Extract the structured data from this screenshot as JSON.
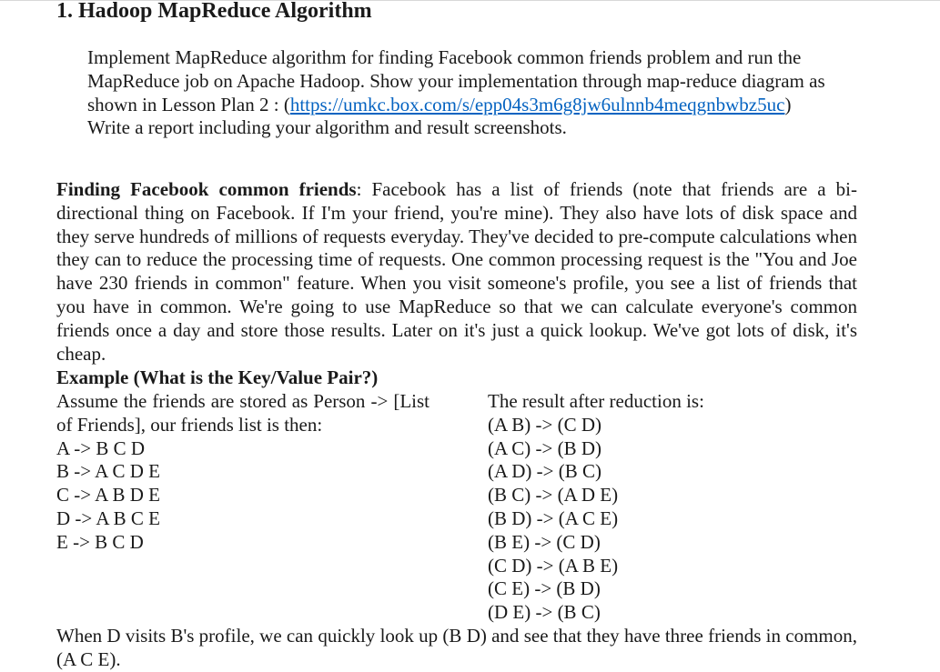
{
  "section": {
    "heading": "1. Hadoop MapReduce Algorithm"
  },
  "task": {
    "text_before_link": "Implement MapReduce algorithm for finding Facebook common friends problem and run the MapReduce job on Apache Hadoop. Show your implementation through map-reduce diagram as shown in Lesson Plan 2 : (",
    "link": "https://umkc.box.com/s/epp04s3m6g8jw6ulnnb4meqgnbwbz5uc",
    "text_after_link": ")",
    "line2": "Write a report including your algorithm and result screenshots."
  },
  "problem": {
    "bold_lead": "Finding Facebook common friends",
    "text": ": Facebook has a list of friends (note that friends are a bi-directional thing on Facebook. If I'm your friend, you're mine). They also have lots of disk space and they serve hundreds of millions of requests everyday. They've decided to pre-compute calculations when they can to reduce the processing time of requests. One common processing request is the \"You and Joe have 230 friends in common\" feature. When you visit someone's profile, you see a list of friends that you have in common. We're going to use MapReduce so that we can calculate everyone's common friends once a day and store those results. Later on it's just a quick lookup. We've got lots of disk, it's cheap."
  },
  "example": {
    "title": "Example (What is the Key/Value Pair?)",
    "intro": "Assume the friends are stored as Person -> [List of Friends], our friends list is then:",
    "friends": [
      "A -> B C D",
      "B -> A C D E",
      "C -> A B D E",
      "D -> A B C E",
      "E -> B C D"
    ],
    "result_intro": "The result after reduction is:",
    "results": [
      "(A B) -> (C D)",
      "(A C) -> (B D)",
      "(A D) -> (B C)",
      "(B C) -> (A D E)",
      "(B D) -> (A C E)",
      "(B E) -> (C D)",
      "(C D) -> (A B E)",
      "(C E) -> (B D)",
      "(D E) -> (B C)"
    ]
  },
  "conclusion": "When D visits B's profile, we can quickly look up (B D) and see that they have three friends in common, (A C E)."
}
